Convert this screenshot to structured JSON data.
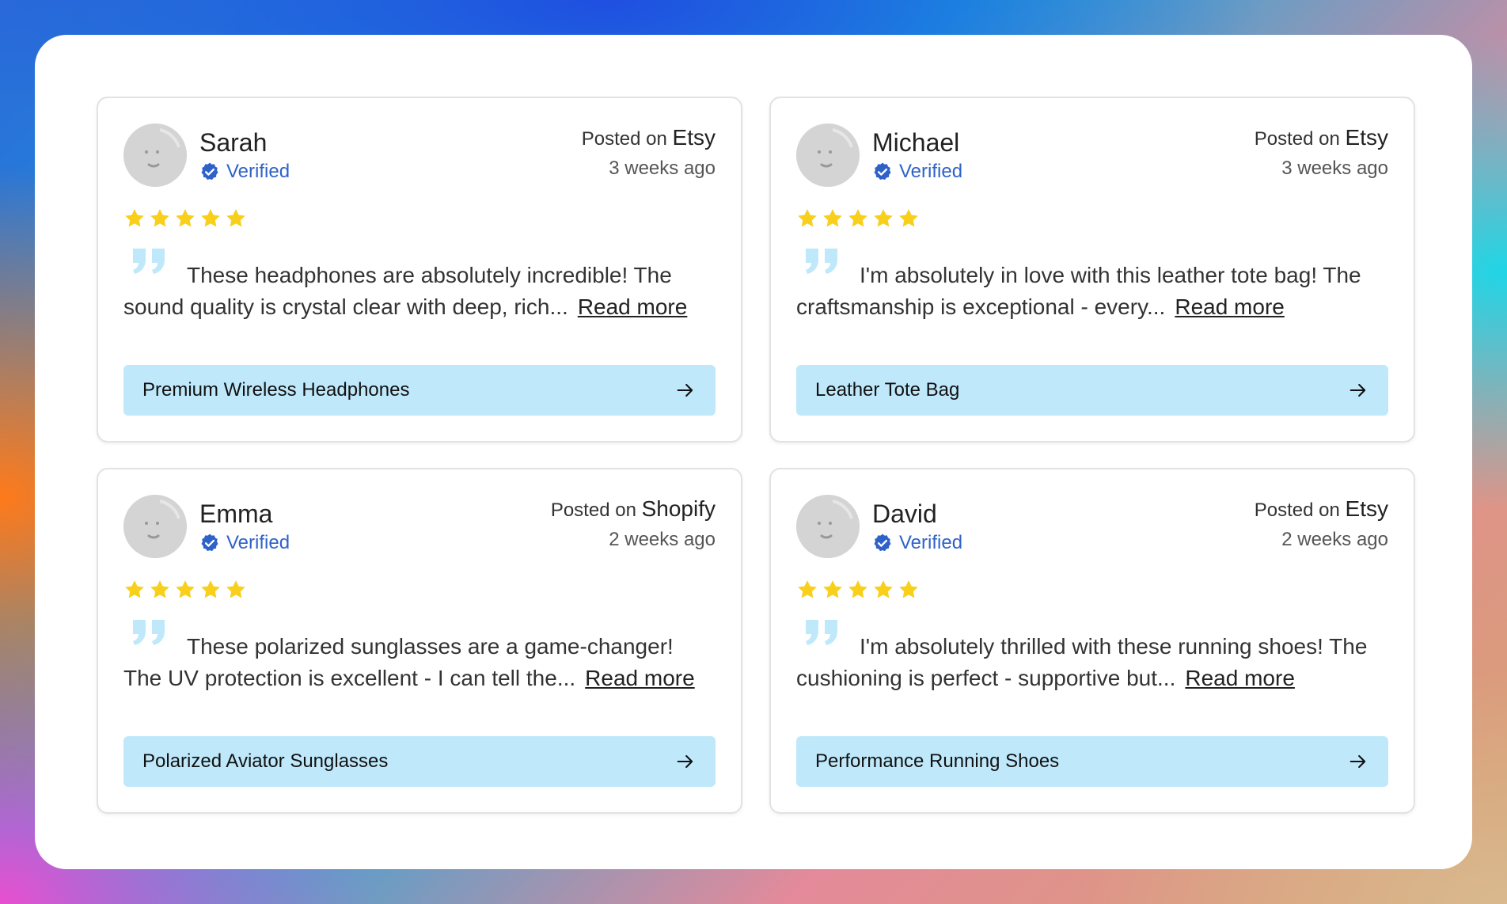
{
  "colors": {
    "verified": "#2f62c8",
    "star": "#f8cf1a",
    "quote": "#bfe9fb",
    "product_bg": "#bfe9fb",
    "avatar": "#d4d4d4"
  },
  "reviews": [
    {
      "name": "Sarah",
      "verified_label": "Verified",
      "posted_prefix": "Posted on",
      "platform": "Etsy",
      "time": "3 weeks ago",
      "rating": 5,
      "text": "These headphones are absolutely incredible! The sound quality is crystal clear with deep, rich...",
      "read_more": "Read more",
      "product": "Premium Wireless Headphones"
    },
    {
      "name": "Michael",
      "verified_label": "Verified",
      "posted_prefix": "Posted on",
      "platform": "Etsy",
      "time": "3 weeks ago",
      "rating": 5,
      "text": "I'm absolutely in love with this leather tote bag! The craftsmanship is exceptional - every...",
      "read_more": "Read more",
      "product": "Leather Tote Bag"
    },
    {
      "name": "Emma",
      "verified_label": "Verified",
      "posted_prefix": "Posted on",
      "platform": "Shopify",
      "time": "2 weeks ago",
      "rating": 5,
      "text": "These polarized sunglasses are a game-changer! The UV protection is excellent - I can tell the...",
      "read_more": "Read more",
      "product": "Polarized Aviator Sunglasses"
    },
    {
      "name": "David",
      "verified_label": "Verified",
      "posted_prefix": "Posted on",
      "platform": "Etsy",
      "time": "2 weeks ago",
      "rating": 5,
      "text": "I'm absolutely thrilled with these running shoes! The cushioning is perfect - supportive but...",
      "read_more": "Read more",
      "product": "Performance Running Shoes"
    }
  ]
}
